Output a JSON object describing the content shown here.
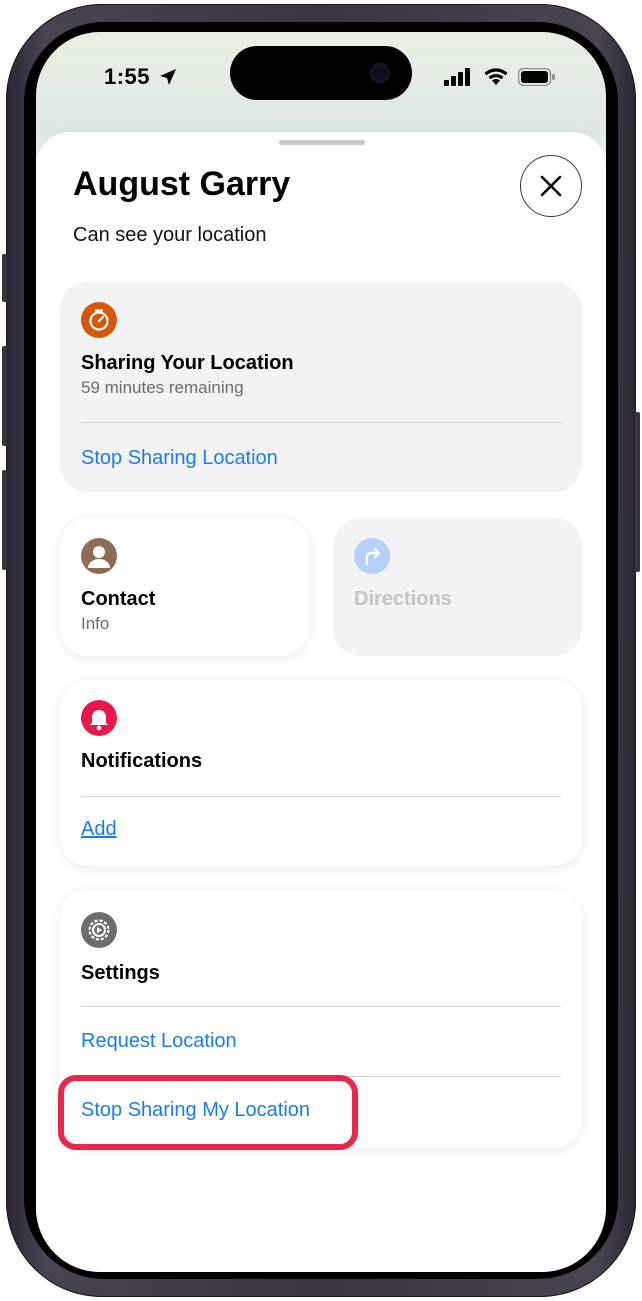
{
  "status_bar": {
    "time": "1:55"
  },
  "sheet": {
    "title": "August Garry",
    "subtitle": "Can see your location"
  },
  "sharing_card": {
    "title": "Sharing Your Location",
    "subtitle": "59 minutes remaining",
    "action": "Stop Sharing Location",
    "icon_color": "#d4570c"
  },
  "contact_card": {
    "title": "Contact",
    "subtitle": "Info",
    "icon_color": "#8f6a55"
  },
  "directions_card": {
    "title": "Directions",
    "icon_color": "#b7d0f7"
  },
  "notifications_card": {
    "title": "Notifications",
    "action": "Add",
    "icon_color": "#e8184d"
  },
  "settings_card": {
    "title": "Settings",
    "actions": [
      "Request Location",
      "Stop Sharing My Location"
    ],
    "icon_color": "#6d6d70"
  },
  "colors": {
    "link": "#1a7cf0",
    "highlight": "#e8284a"
  }
}
